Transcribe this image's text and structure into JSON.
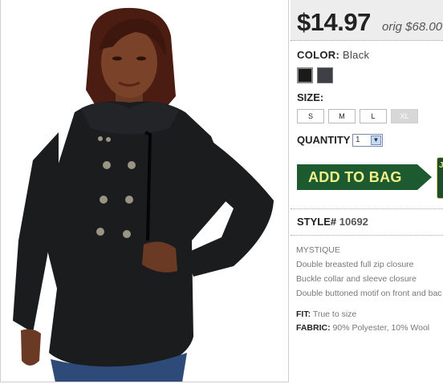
{
  "price": {
    "current": "$14.97",
    "original": "orig $68.00"
  },
  "color": {
    "label": "COLOR:",
    "value": "Black"
  },
  "swatches": [
    {
      "name": "black",
      "color": "#1a1a1a"
    },
    {
      "name": "charcoal",
      "color": "#3d3f45"
    }
  ],
  "size": {
    "label": "SIZE:",
    "options": [
      "S",
      "M",
      "L",
      "XL"
    ],
    "unavailable": "XL"
  },
  "quantity": {
    "label": "QUANTITY",
    "value": "1"
  },
  "add_to_bag": {
    "label": "ADD TO BAG",
    "side_tab": "J"
  },
  "style": {
    "label": "STYLE#",
    "value": "10692"
  },
  "description": {
    "name": "MYSTIQUE",
    "features": [
      "Double breasted full zip closure",
      "Buckle collar and sleeve closure",
      "Double buttoned motif on front and bac"
    ]
  },
  "specs": {
    "fit_label": "FIT:",
    "fit_value": "True to size",
    "fabric_label": "FABRIC:",
    "fabric_value": "90% Polyester, 10% Wool"
  },
  "colors": {
    "add_button": "#1e5a2f",
    "add_text": "#f3f08a",
    "price_bg": "#ededed"
  }
}
